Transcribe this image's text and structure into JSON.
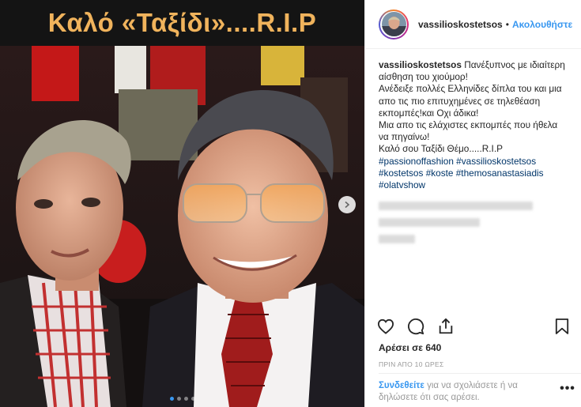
{
  "banner": {
    "title": "Καλό «Ταξίδι»....R.I.P"
  },
  "header": {
    "username": "vassilioskostetsos",
    "separator": "•",
    "follow_label": "Ακολουθήστε"
  },
  "caption": {
    "username": "vassilioskostetsos",
    "lines": [
      "Πανέξυπνος με ιδιαίτερη",
      "αίσθηση του χιούμορ!",
      "Ανέδειξε πολλές Ελληνίδες δίπλα του και μια",
      "απο τις πιο επιτυχημένες σε τηλεθέαση",
      "εκπομπές!και Οχι άδικα!",
      "Μια απο τις ελάχιστες εκπομπές που ήθελα",
      "να πηγαίνω!",
      "Καλό σου Ταξίδι Θέμο.....R.I.P"
    ],
    "hashtag_lines": [
      [
        "#passionoffashion",
        "#vassilioskostetsos"
      ],
      [
        "#kostetsos",
        "#koste",
        "#themosanastasiadis"
      ],
      [
        "#olatvshow"
      ]
    ]
  },
  "icons": {
    "like": "heart-icon",
    "comment": "comment-icon",
    "share": "share-icon",
    "save": "bookmark-icon",
    "next": "chevron-right-icon",
    "more": "more-icon"
  },
  "likes": {
    "text": "Αρέσει σε 640"
  },
  "timestamp": {
    "text": "ΠΡΙΝ ΑΠΟ 10 ΩΡΕΣ"
  },
  "comment_prompt": {
    "login_label": "Συνδεθείτε",
    "rest": " για να σχολιάσετε ή να δηλώσετε ότι σας αρέσει."
  },
  "more_label": "•••",
  "carousel": {
    "slide_count": 4,
    "active_index": 0
  },
  "colors": {
    "banner_text": "#f0b35c",
    "link_blue": "#3897f0",
    "hashtag": "#003569"
  }
}
